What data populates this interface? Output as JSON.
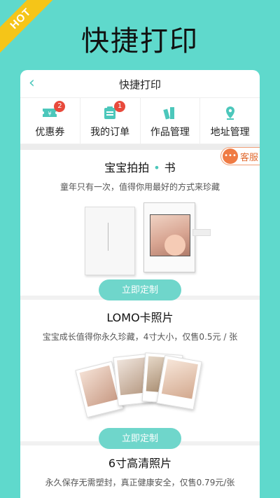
{
  "ribbon": "HOT",
  "headline": "快捷打印",
  "navbar": {
    "back_icon": "‹",
    "title": "快捷打印"
  },
  "quick_actions": [
    {
      "label": "优惠券",
      "badge": "2",
      "icon": "coupon-icon"
    },
    {
      "label": "我的订单",
      "badge": "1",
      "icon": "order-icon"
    },
    {
      "label": "作品管理",
      "icon": "works-icon"
    },
    {
      "label": "地址管理",
      "icon": "location-icon"
    }
  ],
  "service": {
    "label": "客服",
    "icon": "chat-icon"
  },
  "products": [
    {
      "title_a": "宝宝拍拍",
      "dot": "•",
      "title_b": "书",
      "desc": "童年只有一次，值得你用最好的方式来珍藏",
      "button": "立即定制"
    },
    {
      "title": "LOMO卡照片",
      "desc": "宝宝成长值得你永久珍藏，4寸大小，仅售0.5元 / 张",
      "button": "立即定制"
    },
    {
      "title": "6寸高清照片",
      "desc": "永久保存无需塑封，真正健康安全，仅售0.79元/张"
    }
  ],
  "colors": {
    "background": "#5fd9cc",
    "accent": "#6fd6cb",
    "badge": "#e84a3c",
    "hot": "#f5c518",
    "service": "#ef7b44"
  }
}
